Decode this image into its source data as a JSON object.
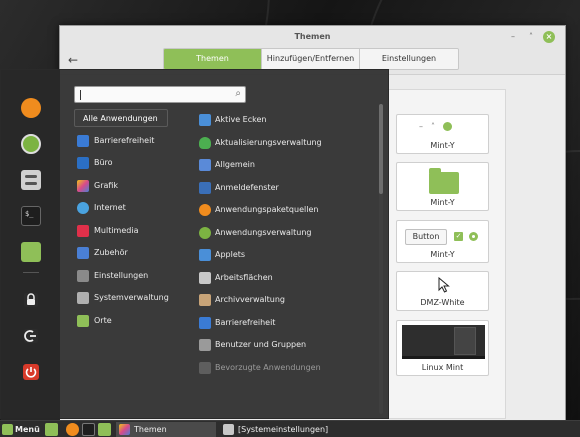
{
  "window": {
    "title": "Themen",
    "back_glyph": "←",
    "min_glyph": "–",
    "max_glyph": "˄",
    "close_glyph": "×"
  },
  "tabs": [
    {
      "label": "Themen",
      "active": true
    },
    {
      "label": "Hinzufügen/Entfernen",
      "active": false
    },
    {
      "label": "Einstellungen",
      "active": false
    }
  ],
  "theme_cards": [
    {
      "label": "Mint-Y",
      "preview": "window-buttons"
    },
    {
      "label": "Mint-Y",
      "preview": "folder"
    },
    {
      "label": "Mint-Y",
      "preview": "controls",
      "button_label": "Button"
    },
    {
      "label": "DMZ-White",
      "preview": "cursor"
    },
    {
      "label": "Linux Mint",
      "preview": "desktop"
    }
  ],
  "menu": {
    "search_placeholder": "",
    "favorites": [
      {
        "icon": "firefox-icon",
        "color": "#f08c1e"
      },
      {
        "icon": "software-manager-icon",
        "color": "#7cb342"
      },
      {
        "icon": "system-settings-icon",
        "color": "#d0d0d0"
      },
      {
        "icon": "terminal-icon",
        "color": "#1e1e1e"
      },
      {
        "icon": "files-icon",
        "color": "#8fbf58"
      }
    ],
    "session": [
      {
        "icon": "lock-icon",
        "color": "#333333"
      },
      {
        "icon": "logout-icon",
        "color": "#333333"
      },
      {
        "icon": "power-icon",
        "color": "#d83a2a"
      }
    ],
    "categories": [
      {
        "label": "Alle Anwendungen",
        "selected": true,
        "color": ""
      },
      {
        "label": "Barrierefreiheit",
        "color": "#3a7bd5"
      },
      {
        "label": "Büro",
        "color": "#2b6fc4"
      },
      {
        "label": "Grafik",
        "color": "#d84a8a"
      },
      {
        "label": "Internet",
        "color": "#4aa3e0"
      },
      {
        "label": "Multimedia",
        "color": "#e0304a"
      },
      {
        "label": "Zubehör",
        "color": "#4a7fd4"
      },
      {
        "label": "Einstellungen",
        "color": "#8a8a8a"
      },
      {
        "label": "Systemverwaltung",
        "color": "#b0b0b0"
      },
      {
        "label": "Orte",
        "color": "#8fbf58"
      }
    ],
    "apps": [
      {
        "label": "Aktive Ecken",
        "color": "#4a8fd8"
      },
      {
        "label": "Aktualisierungsverwaltung",
        "color": "#4caf50"
      },
      {
        "label": "Allgemein",
        "color": "#5a8ad8"
      },
      {
        "label": "Anmeldefenster",
        "color": "#3a6fb8"
      },
      {
        "label": "Anwendungspaketquellen",
        "color": "#f08c1e"
      },
      {
        "label": "Anwendungsverwaltung",
        "color": "#7cb342"
      },
      {
        "label": "Applets",
        "color": "#4a8fd8"
      },
      {
        "label": "Arbeitsflächen",
        "color": "#c8c8c8"
      },
      {
        "label": "Archivverwaltung",
        "color": "#c8a478"
      },
      {
        "label": "Barrierefreiheit",
        "color": "#3a7bd5"
      },
      {
        "label": "Benutzer und Gruppen",
        "color": "#9a9a9a"
      },
      {
        "label": "Bevorzugte Anwendungen",
        "color": "#777777",
        "faded": true
      }
    ]
  },
  "taskbar": {
    "menu_label": "Menü",
    "tasks": [
      {
        "label": "Themen"
      },
      {
        "label": "[Systemeinstellungen]"
      }
    ]
  },
  "colors": {
    "accent": "#8fbf58",
    "menu_bg": "#343434",
    "window_bg": "#e6e6e6"
  }
}
